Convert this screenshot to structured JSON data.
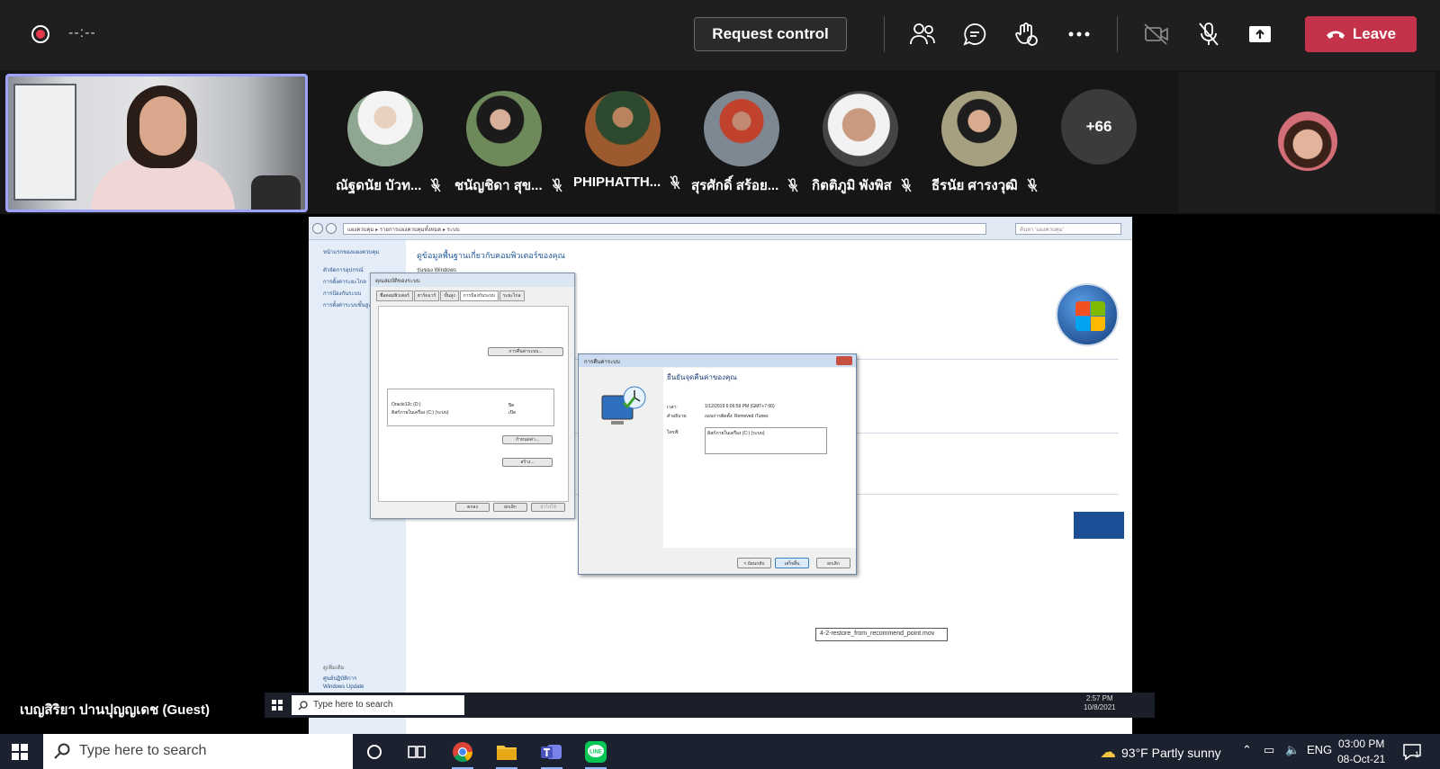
{
  "meeting": {
    "timer": "--:--",
    "request_control_label": "Request control",
    "leave_label": "Leave"
  },
  "participants": [
    {
      "name": "ณัฐดนัย บัวท...",
      "muted": true
    },
    {
      "name": "ชนัญชิดา สุข...",
      "muted": true
    },
    {
      "name": "PHIPHATTH...",
      "muted": true
    },
    {
      "name": "สุรศักดิ์ สร้อย...",
      "muted": true
    },
    {
      "name": "กิตติภูมิ พังพิส",
      "muted": true
    },
    {
      "name": "ธีรนัย ศารงวุฒิ",
      "muted": true
    }
  ],
  "overflow_count": "+66",
  "presenter": {
    "name": "เบญสิริยา ปานปุญญเดช (Guest)"
  },
  "shared_screen": {
    "explorer_title": "ดูข้อมูลพื้นฐานเกี่ยวกับคอมพิวเตอร์ของคุณ",
    "explorer_subtitle": "รุ่นของ Windows",
    "address": "แผงควบคุม ▸ รายการแผงควบคุมทั้งหมด ▸ ระบบ",
    "search_placeholder": "ค้นหา 'แผงควบคุม'",
    "sidebar_links": [
      "หน้าแรกของแผงควบคุม",
      "ตัวจัดการอุปกรณ์",
      "การตั้งค่าระยะไกล",
      "การป้องกันระบบ",
      "การตั้งค่าระบบขั้นสูง"
    ],
    "sidebar_bottom": [
      "ดูเพิ่มเติม",
      "ศูนย์ปฏิบัติการ",
      "Windows Update"
    ],
    "dialog1": {
      "title": "คุณสมบัติของระบบ",
      "tabs": [
        "ชื่อคอมพิวเตอร์",
        "ฮาร์ดแวร์",
        "ขั้นสูง",
        "การป้องกันระบบ",
        "ระยะไกล"
      ],
      "drive1": "Oracle12c (D:)",
      "drive1_state": "ปิด",
      "drive2": "ดิสก์ภายในเครื่อง (C:) (ระบบ)",
      "drive2_state": "เปิด",
      "restore_button": "การคืนค่าระบบ...",
      "config_button": "กำหนดค่า...",
      "create_button": "สร้าง...",
      "ok": "ตกลง",
      "cancel": "ยกเลิก",
      "apply": "นำไปใช้"
    },
    "dialog2": {
      "title": "การคืนค่าระบบ",
      "heading": "ยืนยันจุดคืนค่าของคุณ",
      "time_label": "เวลา:",
      "time_value": "1/12/2019 6:06:59 PM (GMT+7:00)",
      "desc_label": "คำอธิบาย:",
      "desc_value": "ถอนการติดตั้ง: Removed iTunes",
      "drive_label": "ไดรฟ์:",
      "drive_value": "ดิสก์ภายในเครื่อง (C:) (ระบบ)",
      "back": "< ย้อนกลับ",
      "finish": "เสร็จสิ้น",
      "cancel": "ยกเลิก"
    },
    "tooltip": "4-2-restore_from_recommend_point.mov",
    "vm_search_placeholder": "Type here to search",
    "vm_time": "2:57 PM",
    "vm_date": "10/8/2021"
  },
  "taskbar": {
    "search_placeholder": "Type here to search",
    "weather": "93°F  Partly sunny",
    "lang": "ENG",
    "time": "03:00 PM",
    "date": "08-Oct-21",
    "notif_count": "1"
  },
  "colors": {
    "leave": "#c4314b",
    "selected_border": "#9ea2ff"
  }
}
